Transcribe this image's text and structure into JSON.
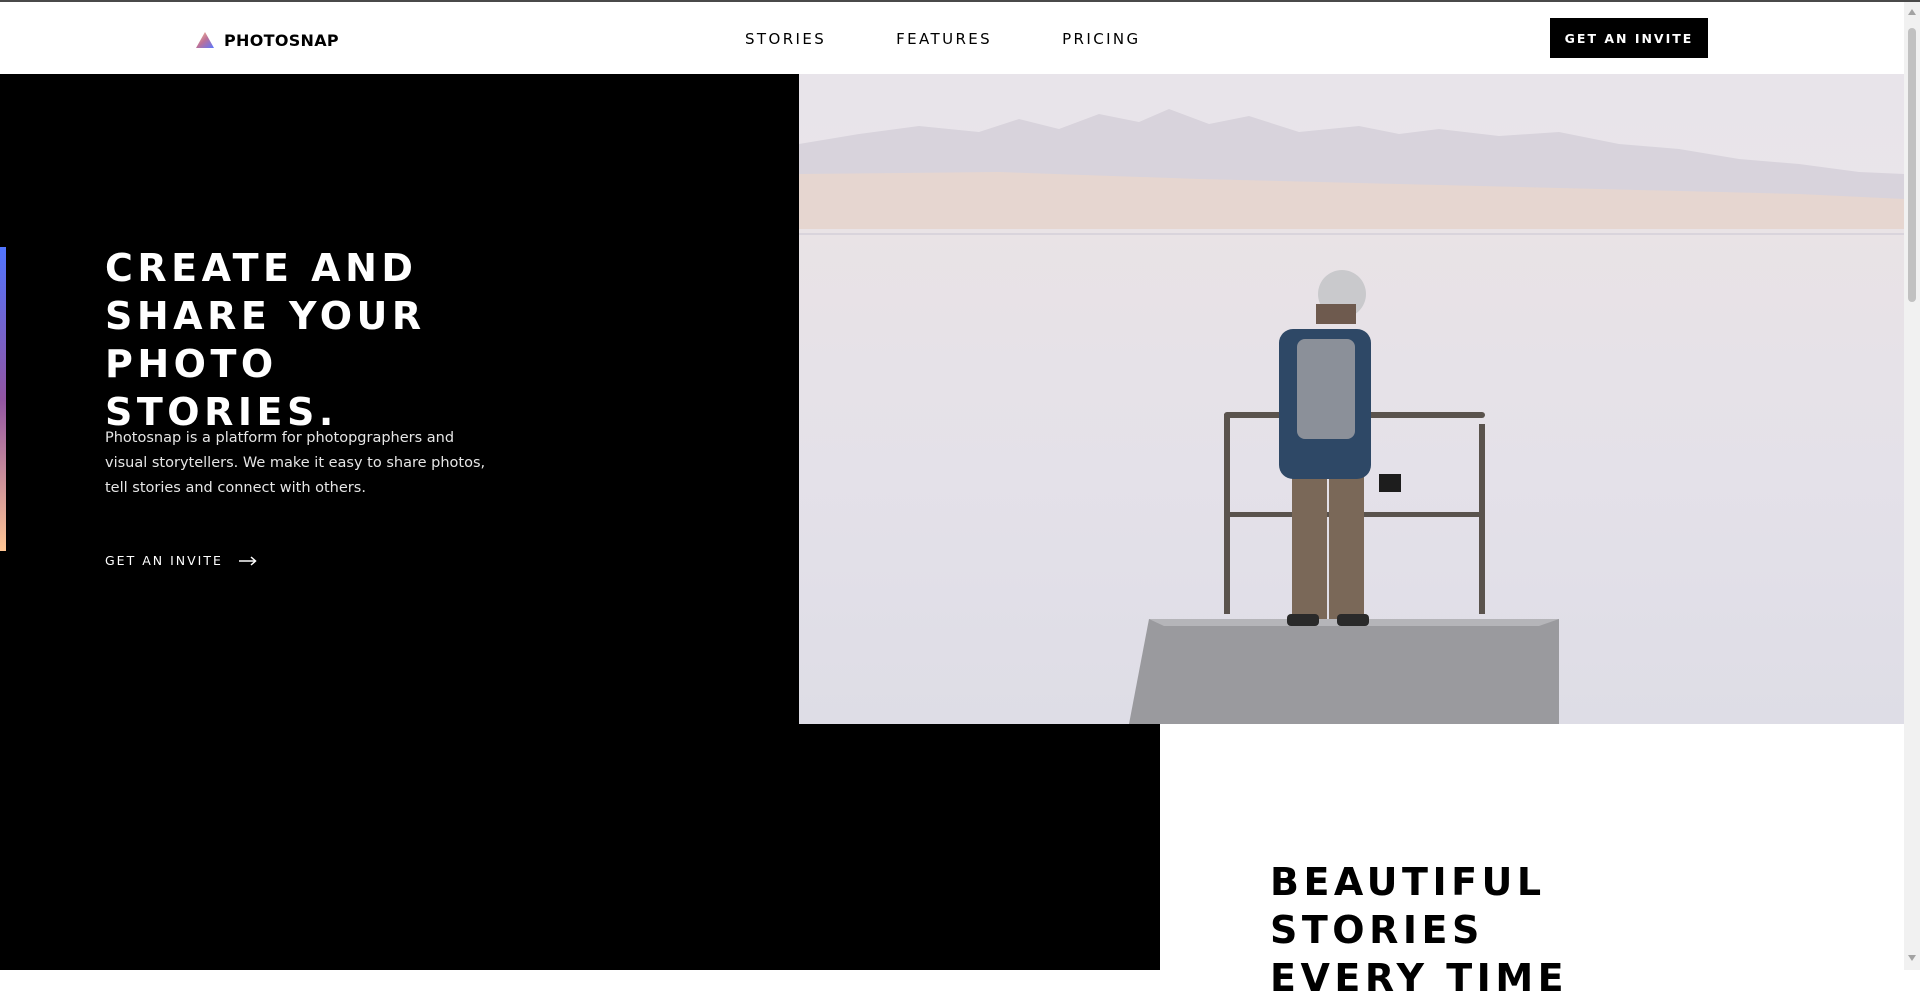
{
  "header": {
    "logo_text": "PHOTOSNAP",
    "nav": [
      "STORIES",
      "FEATURES",
      "PRICING"
    ],
    "cta_label": "GET AN INVITE"
  },
  "hero": {
    "title_lines": [
      "CREATE AND",
      "SHARE YOUR",
      "PHOTO STORIES."
    ],
    "description": "Photosnap is a platform for photopgraphers and visual storytellers. We make it easy to share photos, tell stories and connect with others.",
    "link_label": "GET AN INVITE",
    "image_alt": "Photographer standing on a dock by a lake"
  },
  "section2": {
    "title_lines": [
      "BEAUTIFUL",
      "STORIES",
      "EVERY TIME"
    ]
  },
  "colors": {
    "accent_gradient": [
      "#5175ff",
      "#9255a3",
      "#ffc593"
    ],
    "dark": "#000000",
    "light": "#ffffff"
  },
  "icons": {
    "logo": "triangle-gradient-logo-icon",
    "link_arrow": "arrow-right-icon"
  }
}
